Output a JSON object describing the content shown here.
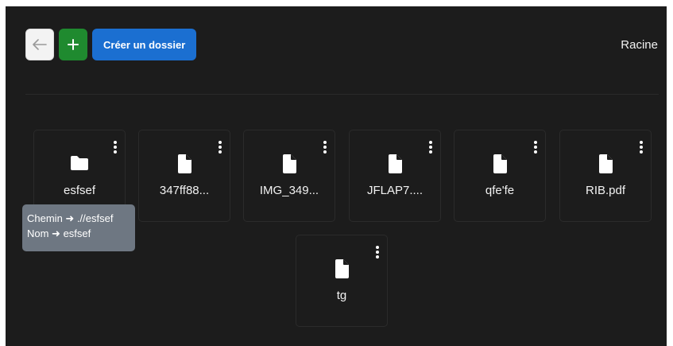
{
  "toolbar": {
    "back_icon": "arrow-left-icon",
    "add_icon": "plus-icon",
    "create_folder_label": "Créer un dossier"
  },
  "breadcrumb": "Racine",
  "files": [
    {
      "name": "esfsef",
      "type": "folder"
    },
    {
      "name": "347ff88...",
      "type": "file"
    },
    {
      "name": "IMG_349...",
      "type": "file"
    },
    {
      "name": "JFLAP7....",
      "type": "file"
    },
    {
      "name": "qfe'fe",
      "type": "file"
    },
    {
      "name": "RIB.pdf",
      "type": "file"
    },
    {
      "name": "tg",
      "type": "file"
    }
  ],
  "tooltip": {
    "path_line": "Chemin ➜ .//esfsef",
    "name_line": "Nom ➜ esfsef"
  },
  "colors": {
    "background": "#1c1c1c",
    "add_button": "#1f8a2f",
    "create_button": "#1b6fd1",
    "tooltip": "#6e7782"
  }
}
